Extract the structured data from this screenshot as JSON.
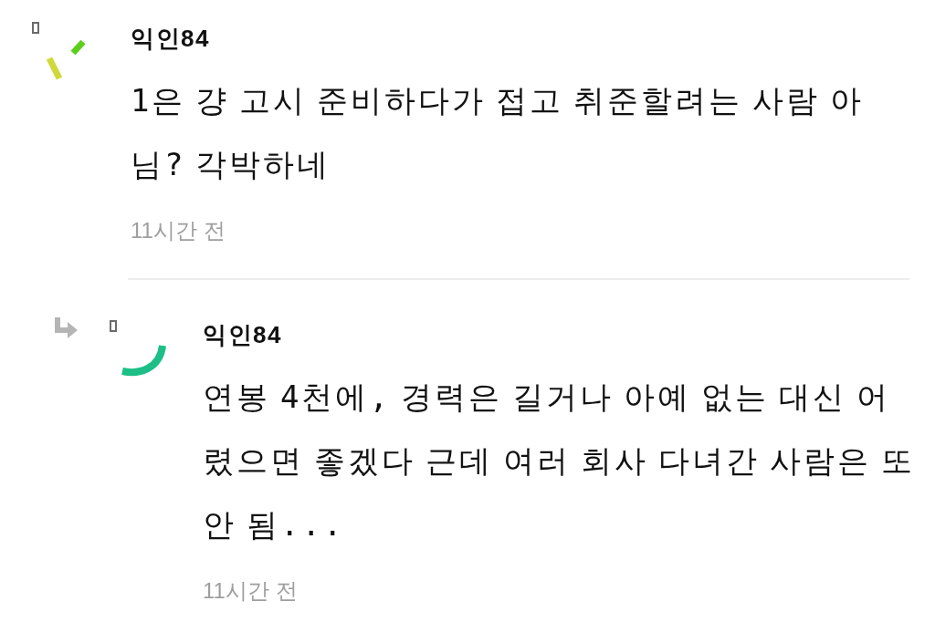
{
  "comments": [
    {
      "kind": "comment",
      "author": "익인84",
      "body": "1은 걍 고시 준비하다가 접고 취준할려는 사람 아님? 각박하네",
      "time": "11시간 전"
    },
    {
      "kind": "reply",
      "author": "익인84",
      "body": "연봉 4천에, 경력은 길거나 아예 없는 대신 어렸으면 좋겠다 근데 여러 회사 다녀간 사람은 또 안 됨...",
      "time": "11시간 전"
    }
  ]
}
